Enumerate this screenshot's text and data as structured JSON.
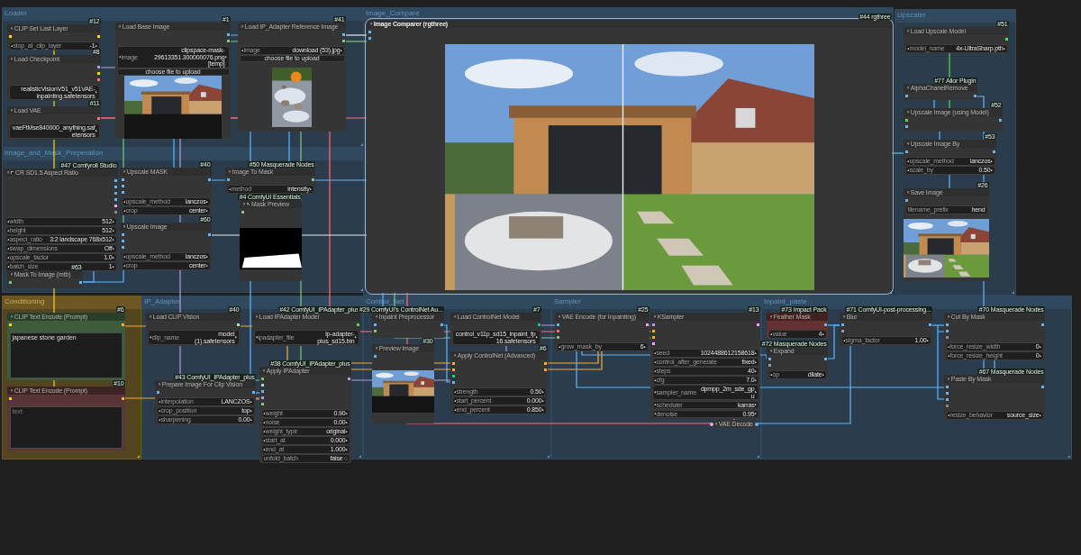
{
  "groups": [
    {
      "title": "Loader",
      "color": "#30495f",
      "nodes": [
        {
          "title": "CLIP Set Last Layer",
          "badge": "#12",
          "selected": false,
          "collapsed": false,
          "inputs": [
            {
              "color": "#ffd500"
            }
          ],
          "outputs": [
            {
              "color": "#ffd500"
            }
          ],
          "widgets": [
            {
              "kind": "number",
              "label": "stop_at_clip_layer",
              "value": "-1"
            }
          ]
        },
        {
          "title": "Load Checkpoint",
          "badge": "#8",
          "selected": false,
          "collapsed": false,
          "outputs": [
            {
              "color": "#b39ddb"
            },
            {
              "color": "#ffd500"
            },
            {
              "color": "#ff6e6e"
            }
          ],
          "widgets": [
            {
              "kind": "combo",
              "value": "realisticVisionV51_v51VAE-inpainting.safetensors"
            }
          ]
        },
        {
          "title": "Load VAE",
          "badge": "#11",
          "selected": false,
          "collapsed": false,
          "outputs": [
            {
              "color": "#ff6e6e"
            }
          ],
          "widgets": [
            {
              "kind": "combo",
              "value": "vaeFtMse840000_anything.safetensors"
            }
          ]
        },
        {
          "title": "Load Base Image",
          "badge": "#1",
          "selected": false,
          "collapsed": false,
          "outputs": [
            {
              "color": "#64b5f6"
            },
            {
              "color": "#81c784"
            }
          ],
          "widgets": [
            {
              "kind": "combo",
              "label": "image",
              "value": "clipspace-mask-29613351.300000076.png [temp]"
            },
            {
              "kind": "button",
              "label": "choose file to upload"
            }
          ]
        },
        {
          "title": "Load IP_Adapter Reference Image",
          "badge": "#41",
          "selected": false,
          "collapsed": false,
          "outputs": [
            {
              "color": "#64b5f6"
            },
            {
              "color": "#81c784"
            }
          ],
          "widgets": [
            {
              "kind": "combo",
              "label": "image",
              "value": "download (53).jpg"
            },
            {
              "kind": "button",
              "label": "choose file to upload"
            }
          ]
        }
      ]
    },
    {
      "title": "Image_and_Mask_Preperation",
      "color": "#30495f",
      "nodes": [
        {
          "title": "CR SD1.5 Aspect Ratio",
          "badge": "#47 Comfyroll Studio",
          "selected": false,
          "collapsed": false,
          "outputs": [
            {
              "color": "#64b5f6"
            },
            {
              "color": "#64b5f6"
            },
            {
              "color": "#7f9fbf"
            },
            {
              "color": "#64b5f6"
            },
            {
              "color": "#ff9cf9"
            },
            {
              "color": "#8a8a8a"
            }
          ],
          "widgets": [
            {
              "kind": "number",
              "label": "width",
              "value": "512"
            },
            {
              "kind": "number",
              "label": "height",
              "value": "512"
            },
            {
              "kind": "combo",
              "label": "aspect_ratio",
              "value": "3:2 landscape 768x512"
            },
            {
              "kind": "combo",
              "label": "swap_dimensions",
              "value": "Off"
            },
            {
              "kind": "number",
              "label": "upscale_factor",
              "value": "1.0"
            },
            {
              "kind": "number",
              "label": "batch_size",
              "value": "1"
            }
          ]
        },
        {
          "title": "Upscale MASK",
          "badge": "#40",
          "selected": false,
          "collapsed": false,
          "inputs": [
            {
              "color": "#64b5f6"
            },
            {
              "color": "#64b5f6"
            },
            {
              "color": "#64b5f6"
            }
          ],
          "outputs": [
            {
              "color": "#64b5f6"
            }
          ],
          "widgets": [
            {
              "kind": "combo",
              "label": "upscale_method",
              "value": "lanczos"
            },
            {
              "kind": "combo",
              "label": "crop",
              "value": "center"
            }
          ]
        },
        {
          "title": "Upscale Image",
          "badge": "#60",
          "selected": false,
          "collapsed": false,
          "inputs": [
            {
              "color": "#64b5f6"
            },
            {
              "color": "#64b5f6"
            },
            {
              "color": "#64b5f6"
            }
          ],
          "outputs": [
            {
              "color": "#64b5f6"
            }
          ],
          "widgets": [
            {
              "kind": "combo",
              "label": "upscale_method",
              "value": "lanczos"
            },
            {
              "kind": "combo",
              "label": "crop",
              "value": "center"
            }
          ]
        },
        {
          "title": "Mask To Image (mtb)",
          "badge": "#63",
          "selected": false,
          "collapsed": false,
          "inputs": [
            {
              "color": "#81c784"
            }
          ],
          "outputs": [
            {
              "color": "#64b5f6"
            }
          ]
        },
        {
          "title": "Image To Mask",
          "badge": "#50 Masquerade Nodes",
          "selected": false,
          "collapsed": false,
          "inputs": [
            {
              "color": "#64b5f6"
            }
          ],
          "outputs": [
            {
              "color": "#81c784"
            }
          ],
          "widgets": [
            {
              "kind": "combo",
              "label": "method",
              "value": "intensity"
            }
          ]
        },
        {
          "title": "Mask Preview",
          "badge": "#4 ComfyUI Essentials",
          "selected": false,
          "collapsed": false,
          "inputs": [
            {
              "color": "#81c784"
            }
          ]
        }
      ]
    },
    {
      "title": "Image_Compare",
      "color": "#30495f",
      "nodes": [
        {
          "title": "Image Comparer (rgthree)",
          "badge": "#44 rgthree",
          "selected": true,
          "collapsed": false,
          "inputs": [
            {
              "color": "#64b5f6"
            },
            {
              "color": "#64b5f6"
            }
          ]
        }
      ]
    },
    {
      "title": "Upscaler",
      "color": "#30495f",
      "nodes": [
        {
          "title": "Load Upscale Model",
          "badge": "#51",
          "selected": false,
          "collapsed": false,
          "outputs": [
            {
              "color": "#5ad35a"
            }
          ],
          "widgets": [
            {
              "kind": "combo",
              "label": "model_name",
              "value": "4x-UltraSharp.pth"
            }
          ]
        },
        {
          "title": "AlphaChanelRemove",
          "badge": "#77 Allor Plugin",
          "selected": false,
          "collapsed": false,
          "inputs": [
            {
              "color": "#64b5f6"
            }
          ],
          "outputs": [
            {
              "color": "#64b5f6"
            }
          ]
        },
        {
          "title": "Upscale Image (using Model)",
          "badge": "#52",
          "selected": false,
          "collapsed": false,
          "inputs": [
            {
              "color": "#5ad35a"
            },
            {
              "color": "#64b5f6"
            }
          ],
          "outputs": [
            {
              "color": "#64b5f6"
            }
          ]
        },
        {
          "title": "Upscale Image By",
          "badge": "#53",
          "selected": false,
          "collapsed": false,
          "inputs": [
            {
              "color": "#64b5f6"
            }
          ],
          "outputs": [
            {
              "color": "#64b5f6"
            }
          ],
          "widgets": [
            {
              "kind": "combo",
              "label": "upscale_method",
              "value": "lanczos"
            },
            {
              "kind": "number",
              "label": "scale_by",
              "value": "0.50"
            }
          ]
        },
        {
          "title": "Save Image",
          "badge": "#26",
          "selected": false,
          "collapsed": false,
          "inputs": [
            {
              "color": "#64b5f6"
            }
          ],
          "widgets": [
            {
              "kind": "text",
              "label": "filename_prefix",
              "value": "hend"
            }
          ]
        }
      ]
    },
    {
      "title": "Conditioning",
      "color": "#6b5624",
      "nodes": [
        {
          "title": "CLIP Text Encode (Prompt)",
          "badge": "#6",
          "color": "#3c5c3c",
          "selected": false,
          "collapsed": false,
          "inputs": [
            {
              "color": "#ffd500"
            }
          ],
          "outputs": [
            {
              "color": "#ffa931"
            }
          ],
          "widgets": [
            {
              "kind": "textarea",
              "value": "japanese stone garden"
            }
          ]
        },
        {
          "title": "CLIP Text Encode (Prompt)",
          "badge": "#10",
          "color": "#5a3535",
          "selected": false,
          "collapsed": false,
          "inputs": [
            {
              "color": "#ffd500"
            }
          ],
          "outputs": [
            {
              "color": "#ffa931"
            }
          ],
          "widgets": [
            {
              "kind": "textarea",
              "placeholder": "text"
            }
          ]
        }
      ]
    },
    {
      "title": "IP_Adapter",
      "color": "#30495f",
      "nodes": [
        {
          "title": "Load CLIP Vision",
          "badge": "#40",
          "selected": false,
          "collapsed": false,
          "outputs": [
            {
              "color": "#a8dadc"
            }
          ],
          "widgets": [
            {
              "kind": "combo",
              "label": "clip_name",
              "value": "model (1).safetensors"
            }
          ]
        },
        {
          "title": "Load IPAdapter Model",
          "badge": "#42 ComfyUI_IPAdapter_plus",
          "selected": false,
          "collapsed": false,
          "outputs": [
            {
              "color": "#5ad35a"
            }
          ],
          "widgets": [
            {
              "kind": "combo",
              "label": "ipadapter_file",
              "value": "ip-adapter-plus_sd15.bin"
            }
          ]
        },
        {
          "title": "Prepare Image For Clip Vision",
          "badge": "#43 ComfyUI_IPAdapter_plus",
          "selected": false,
          "collapsed": false,
          "inputs": [
            {
              "color": "#64b5f6"
            }
          ],
          "outputs": [
            {
              "color": "#64b5f6"
            }
          ],
          "widgets": [
            {
              "kind": "combo",
              "label": "interpolation",
              "value": "LANCZOS"
            },
            {
              "kind": "combo",
              "label": "crop_position",
              "value": "top"
            },
            {
              "kind": "number",
              "label": "sharpening",
              "value": "0.00"
            }
          ]
        },
        {
          "title": "Apply IPAdapter",
          "badge": "#38 ComfyUI_IPAdapter_plus",
          "selected": false,
          "collapsed": false,
          "inputs": [
            {
              "color": "#5ad35a"
            },
            {
              "color": "#a8dadc"
            },
            {
              "color": "#64b5f6"
            },
            {
              "color": "#b39ddb"
            },
            {
              "color": "#81c784"
            }
          ],
          "outputs": [
            {
              "color": "#b39ddb"
            }
          ],
          "widgets": [
            {
              "kind": "number",
              "label": "weight",
              "value": "0.90"
            },
            {
              "kind": "number",
              "label": "noise",
              "value": "0.00"
            },
            {
              "kind": "combo",
              "label": "weight_type",
              "value": "original"
            },
            {
              "kind": "number",
              "label": "start_at",
              "value": "0.000"
            },
            {
              "kind": "number",
              "label": "end_at",
              "value": "1.000"
            },
            {
              "kind": "toggle",
              "label": "unfold_batch",
              "value": "false",
              "on": false
            }
          ]
        }
      ]
    },
    {
      "title": "Control_Net",
      "color": "#30495f",
      "nodes": [
        {
          "title": "Inpaint Preprocessor",
          "badge": "#29 ComfyUI's ControlNet Au...",
          "selected": false,
          "collapsed": false,
          "inputs": [
            {
              "color": "#64b5f6"
            },
            {
              "color": "#81c784"
            }
          ],
          "outputs": [
            {
              "color": "#64b5f6"
            }
          ]
        },
        {
          "title": "Load ControlNet Model",
          "badge": "#7",
          "selected": false,
          "collapsed": false,
          "outputs": [
            {
              "color": "#00d78d"
            }
          ],
          "widgets": [
            {
              "kind": "combo",
              "value": "control_v11p_sd15_inpaint_fp16.safetensors"
            }
          ]
        },
        {
          "title": "Preview Image",
          "badge": "#30",
          "selected": false,
          "collapsed": false,
          "inputs": [
            {
              "color": "#64b5f6"
            }
          ]
        },
        {
          "title": "Apply ControlNet (Advanced)",
          "badge": "#6",
          "selected": false,
          "collapsed": false,
          "inputs": [
            {
              "color": "#ffa931"
            },
            {
              "color": "#ffa931"
            },
            {
              "color": "#00d78d"
            },
            {
              "color": "#64b5f6"
            }
          ],
          "outputs": [
            {
              "color": "#ffa931"
            },
            {
              "color": "#ffa931"
            }
          ],
          "widgets": [
            {
              "kind": "number",
              "label": "strength",
              "value": "0.50"
            },
            {
              "kind": "number",
              "label": "start_percent",
              "value": "0.000"
            },
            {
              "kind": "number",
              "label": "end_percent",
              "value": "0.850"
            }
          ]
        }
      ]
    },
    {
      "title": "Sampler",
      "color": "#30495f",
      "nodes": [
        {
          "title": "VAE Encode (for Inpainting)",
          "badge": "#25",
          "selected": false,
          "collapsed": false,
          "inputs": [
            {
              "color": "#64b5f6"
            },
            {
              "color": "#ff6e6e"
            },
            {
              "color": "#81c784"
            }
          ],
          "outputs": [
            {
              "color": "#ff9cf9"
            }
          ],
          "widgets": [
            {
              "kind": "number",
              "label": "grow_mask_by",
              "value": "6"
            }
          ]
        },
        {
          "title": "KSampler",
          "badge": "#13",
          "selected": false,
          "collapsed": false,
          "inputs": [
            {
              "color": "#b39ddb"
            },
            {
              "color": "#ffa931"
            },
            {
              "color": "#ffa931"
            },
            {
              "color": "#ff9cf9"
            }
          ],
          "outputs": [
            {
              "color": "#ff9cf9"
            }
          ],
          "widgets": [
            {
              "kind": "number",
              "label": "seed",
              "value": "1024488612158618"
            },
            {
              "kind": "combo",
              "label": "control_after_generate",
              "value": "fixed"
            },
            {
              "kind": "number",
              "label": "steps",
              "value": "40"
            },
            {
              "kind": "number",
              "label": "cfg",
              "value": "7.0"
            },
            {
              "kind": "combo",
              "label": "sampler_name",
              "value": "dpmpp_2m_sde_gpu"
            },
            {
              "kind": "combo",
              "label": "scheduler",
              "value": "karras"
            },
            {
              "kind": "number",
              "label": "denoise",
              "value": "0.95"
            }
          ]
        },
        {
          "title": "VAE Decode",
          "selected": false,
          "collapsed": true,
          "inputs": [
            {
              "color": "#ff9cf9"
            }
          ],
          "outputs": [
            {
              "color": "#64b5f6"
            }
          ]
        }
      ]
    },
    {
      "title": "Inpaint_paste",
      "color": "#30495f",
      "nodes": [
        {
          "title": "Feather Mask",
          "badge": "#73 Impact Pack",
          "color": "#643030",
          "selected": false,
          "collapsed": false,
          "outputs": [
            {
              "color": "#64b5f6"
            }
          ],
          "widgets": [
            {
              "kind": "number",
              "label": "value",
              "value": "4"
            }
          ]
        },
        {
          "title": "Expand",
          "badge": "#72 Masquerade Nodes",
          "selected": false,
          "collapsed": false,
          "inputs": [
            {
              "color": "#64b5f6"
            },
            {
              "color": "#7f9fbf"
            }
          ],
          "outputs": [
            {
              "color": "#64b5f6"
            }
          ],
          "widgets": [
            {
              "kind": "combo",
              "label": "op",
              "value": "dilate"
            }
          ]
        },
        {
          "title": "Blur",
          "badge": "#71 ComfyUI-post-processing...",
          "selected": false,
          "collapsed": false,
          "inputs": [
            {
              "color": "#64b5f6"
            },
            {
              "color": "#7f9fbf"
            }
          ],
          "outputs": [
            {
              "color": "#64b5f6"
            }
          ],
          "widgets": [
            {
              "kind": "number",
              "label": "sigma_factor",
              "value": "1.00"
            }
          ]
        },
        {
          "title": "Cut By Mask",
          "badge": "#70 Masquerade Nodes",
          "selected": false,
          "collapsed": false,
          "inputs": [
            {
              "color": "#64b5f6"
            },
            {
              "color": "#64b5f6"
            },
            {
              "color": "#8a8a8a"
            }
          ],
          "outputs": [
            {
              "color": "#64b5f6"
            }
          ],
          "widgets": [
            {
              "kind": "number",
              "label": "force_resize_width",
              "value": "0"
            },
            {
              "kind": "number",
              "label": "force_resize_height",
              "value": "0"
            }
          ]
        },
        {
          "title": "Paste By Mask",
          "badge": "#67 Masquerade Nodes",
          "selected": false,
          "collapsed": false,
          "inputs": [
            {
              "color": "#64b5f6"
            },
            {
              "color": "#64b5f6"
            },
            {
              "color": "#64b5f6"
            },
            {
              "color": "#8a8a8a"
            }
          ],
          "outputs": [
            {
              "color": "#64b5f6"
            }
          ],
          "widgets": [
            {
              "kind": "combo",
              "label": "resize_behavior",
              "value": "source_size"
            }
          ]
        }
      ]
    }
  ]
}
